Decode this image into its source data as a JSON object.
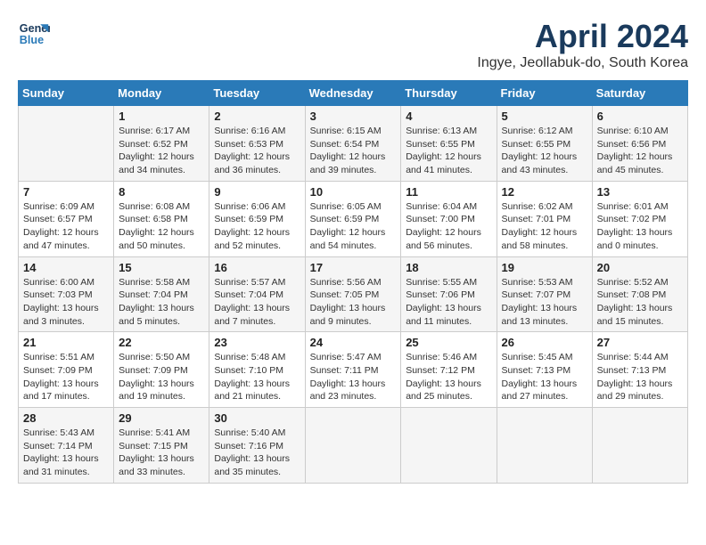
{
  "logo": {
    "line1": "General",
    "line2": "Blue"
  },
  "title": "April 2024",
  "subtitle": "Ingye, Jeollabuk-do, South Korea",
  "weekdays": [
    "Sunday",
    "Monday",
    "Tuesday",
    "Wednesday",
    "Thursday",
    "Friday",
    "Saturday"
  ],
  "weeks": [
    [
      {
        "day": "",
        "info": ""
      },
      {
        "day": "1",
        "info": "Sunrise: 6:17 AM\nSunset: 6:52 PM\nDaylight: 12 hours\nand 34 minutes."
      },
      {
        "day": "2",
        "info": "Sunrise: 6:16 AM\nSunset: 6:53 PM\nDaylight: 12 hours\nand 36 minutes."
      },
      {
        "day": "3",
        "info": "Sunrise: 6:15 AM\nSunset: 6:54 PM\nDaylight: 12 hours\nand 39 minutes."
      },
      {
        "day": "4",
        "info": "Sunrise: 6:13 AM\nSunset: 6:55 PM\nDaylight: 12 hours\nand 41 minutes."
      },
      {
        "day": "5",
        "info": "Sunrise: 6:12 AM\nSunset: 6:55 PM\nDaylight: 12 hours\nand 43 minutes."
      },
      {
        "day": "6",
        "info": "Sunrise: 6:10 AM\nSunset: 6:56 PM\nDaylight: 12 hours\nand 45 minutes."
      }
    ],
    [
      {
        "day": "7",
        "info": "Sunrise: 6:09 AM\nSunset: 6:57 PM\nDaylight: 12 hours\nand 47 minutes."
      },
      {
        "day": "8",
        "info": "Sunrise: 6:08 AM\nSunset: 6:58 PM\nDaylight: 12 hours\nand 50 minutes."
      },
      {
        "day": "9",
        "info": "Sunrise: 6:06 AM\nSunset: 6:59 PM\nDaylight: 12 hours\nand 52 minutes."
      },
      {
        "day": "10",
        "info": "Sunrise: 6:05 AM\nSunset: 6:59 PM\nDaylight: 12 hours\nand 54 minutes."
      },
      {
        "day": "11",
        "info": "Sunrise: 6:04 AM\nSunset: 7:00 PM\nDaylight: 12 hours\nand 56 minutes."
      },
      {
        "day": "12",
        "info": "Sunrise: 6:02 AM\nSunset: 7:01 PM\nDaylight: 12 hours\nand 58 minutes."
      },
      {
        "day": "13",
        "info": "Sunrise: 6:01 AM\nSunset: 7:02 PM\nDaylight: 13 hours\nand 0 minutes."
      }
    ],
    [
      {
        "day": "14",
        "info": "Sunrise: 6:00 AM\nSunset: 7:03 PM\nDaylight: 13 hours\nand 3 minutes."
      },
      {
        "day": "15",
        "info": "Sunrise: 5:58 AM\nSunset: 7:04 PM\nDaylight: 13 hours\nand 5 minutes."
      },
      {
        "day": "16",
        "info": "Sunrise: 5:57 AM\nSunset: 7:04 PM\nDaylight: 13 hours\nand 7 minutes."
      },
      {
        "day": "17",
        "info": "Sunrise: 5:56 AM\nSunset: 7:05 PM\nDaylight: 13 hours\nand 9 minutes."
      },
      {
        "day": "18",
        "info": "Sunrise: 5:55 AM\nSunset: 7:06 PM\nDaylight: 13 hours\nand 11 minutes."
      },
      {
        "day": "19",
        "info": "Sunrise: 5:53 AM\nSunset: 7:07 PM\nDaylight: 13 hours\nand 13 minutes."
      },
      {
        "day": "20",
        "info": "Sunrise: 5:52 AM\nSunset: 7:08 PM\nDaylight: 13 hours\nand 15 minutes."
      }
    ],
    [
      {
        "day": "21",
        "info": "Sunrise: 5:51 AM\nSunset: 7:09 PM\nDaylight: 13 hours\nand 17 minutes."
      },
      {
        "day": "22",
        "info": "Sunrise: 5:50 AM\nSunset: 7:09 PM\nDaylight: 13 hours\nand 19 minutes."
      },
      {
        "day": "23",
        "info": "Sunrise: 5:48 AM\nSunset: 7:10 PM\nDaylight: 13 hours\nand 21 minutes."
      },
      {
        "day": "24",
        "info": "Sunrise: 5:47 AM\nSunset: 7:11 PM\nDaylight: 13 hours\nand 23 minutes."
      },
      {
        "day": "25",
        "info": "Sunrise: 5:46 AM\nSunset: 7:12 PM\nDaylight: 13 hours\nand 25 minutes."
      },
      {
        "day": "26",
        "info": "Sunrise: 5:45 AM\nSunset: 7:13 PM\nDaylight: 13 hours\nand 27 minutes."
      },
      {
        "day": "27",
        "info": "Sunrise: 5:44 AM\nSunset: 7:13 PM\nDaylight: 13 hours\nand 29 minutes."
      }
    ],
    [
      {
        "day": "28",
        "info": "Sunrise: 5:43 AM\nSunset: 7:14 PM\nDaylight: 13 hours\nand 31 minutes."
      },
      {
        "day": "29",
        "info": "Sunrise: 5:41 AM\nSunset: 7:15 PM\nDaylight: 13 hours\nand 33 minutes."
      },
      {
        "day": "30",
        "info": "Sunrise: 5:40 AM\nSunset: 7:16 PM\nDaylight: 13 hours\nand 35 minutes."
      },
      {
        "day": "",
        "info": ""
      },
      {
        "day": "",
        "info": ""
      },
      {
        "day": "",
        "info": ""
      },
      {
        "day": "",
        "info": ""
      }
    ]
  ]
}
